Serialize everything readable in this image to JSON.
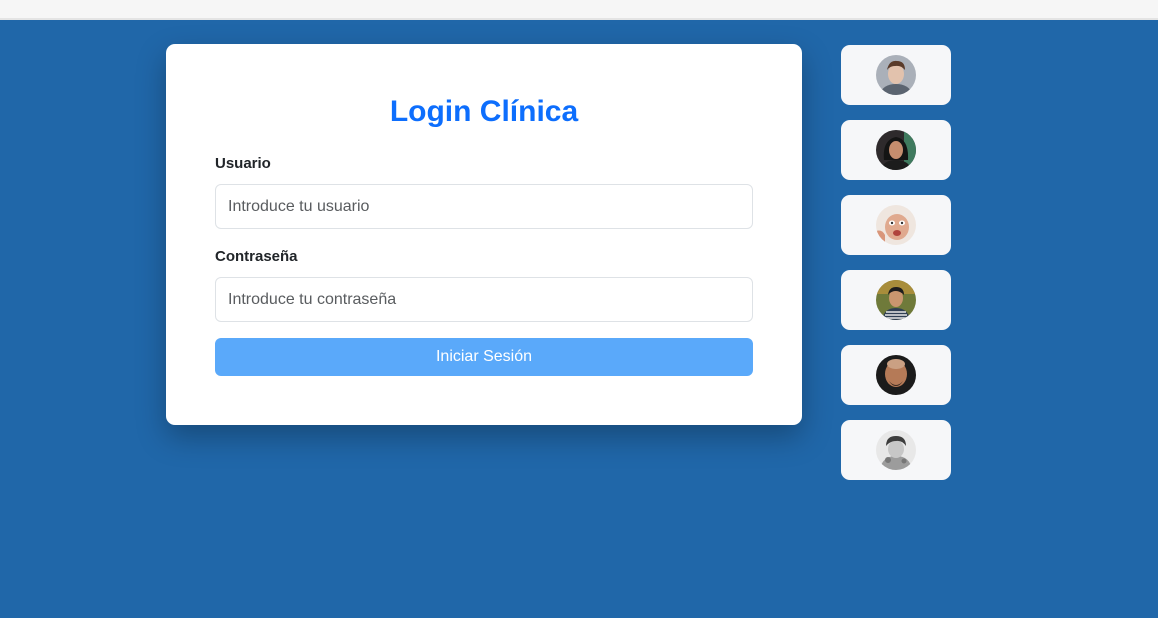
{
  "login": {
    "title": "Login Clínica",
    "username_label": "Usuario",
    "username_placeholder": "Introduce tu usuario",
    "username_value": "",
    "password_label": "Contraseña",
    "password_placeholder": "Introduce tu contraseña",
    "password_value": "",
    "submit_label": "Iniciar Sesión"
  },
  "profiles": [
    {
      "avatar": "avatar-icon"
    },
    {
      "avatar": "avatar-icon"
    },
    {
      "avatar": "avatar-icon"
    },
    {
      "avatar": "avatar-icon"
    },
    {
      "avatar": "avatar-icon"
    },
    {
      "avatar": "avatar-icon"
    }
  ],
  "colors": {
    "page_background": "#2067a9",
    "title": "#0d6efd",
    "button": "#5aa9fa",
    "profile_card": "#f6f7f9"
  }
}
